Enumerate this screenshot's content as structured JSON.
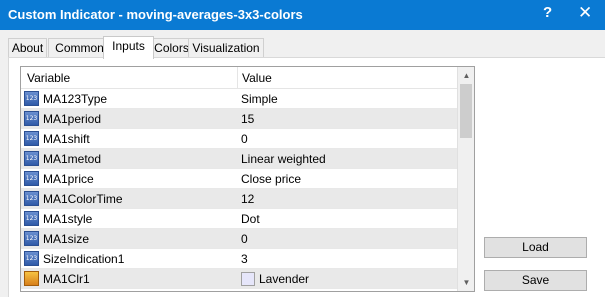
{
  "window": {
    "title": "Custom Indicator - moving-averages-3x3-colors",
    "help": "?",
    "close": "✕"
  },
  "tabs": [
    {
      "label": "About"
    },
    {
      "label": "Common"
    },
    {
      "label": "Inputs"
    },
    {
      "label": "Colors"
    },
    {
      "label": "Visualization"
    }
  ],
  "active_tab": "Inputs",
  "grid": {
    "headers": {
      "variable": "Variable",
      "value": "Value"
    },
    "rows": [
      {
        "name": "MA123Type",
        "value": "Simple"
      },
      {
        "name": "MA1period",
        "value": "15"
      },
      {
        "name": "MA1shift",
        "value": "0"
      },
      {
        "name": "MA1metod",
        "value": "Linear weighted"
      },
      {
        "name": "MA1price",
        "value": "Close price"
      },
      {
        "name": "MA1ColorTime",
        "value": "12"
      },
      {
        "name": "MA1style",
        "value": "Dot"
      },
      {
        "name": "MA1size",
        "value": "0"
      },
      {
        "name": "SizeIndication1",
        "value": "3"
      },
      {
        "name": "MA1Clr1",
        "value": "Lavender",
        "swatch_color": "#e6e6fa"
      }
    ],
    "icon_text": "123"
  },
  "buttons": {
    "load": "Load",
    "save": "Save"
  },
  "colors": {
    "titlebar": "#0a7ad3",
    "row_alt": "#e9e9e9"
  }
}
